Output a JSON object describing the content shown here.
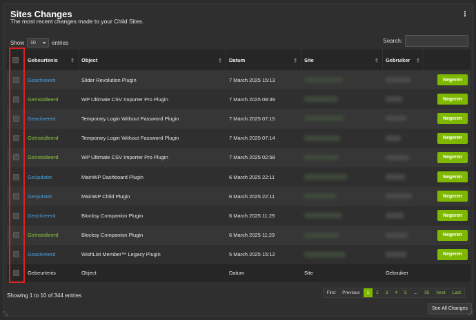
{
  "widget": {
    "title": "Sites Changes",
    "subtitle": "The most recent changes made to your Child Sites."
  },
  "controls": {
    "show_label": "Show",
    "show_value": "10",
    "entries_label": "entries",
    "search_label": "Search:"
  },
  "table": {
    "headers": [
      "Gebeurtenis",
      "Object",
      "Datum",
      "Site",
      "Gebruiker"
    ],
    "rows": [
      {
        "event": "Geactiveerd",
        "event_color": "#4a9fe0",
        "object": "Slider Revolution Plugin",
        "date": "7 March 2025 15:13",
        "action": "Negeren"
      },
      {
        "event": "Geïnstalleerd",
        "event_color": "#8cc63f",
        "object": "WP Ultimate CSV Importer Pro Plugin",
        "date": "7 March 2025 08:39",
        "action": "Negeren"
      },
      {
        "event": "Geactiveerd",
        "event_color": "#4a9fe0",
        "object": "Temporary Login Without Password Plugin",
        "date": "7 March 2025 07:15",
        "action": "Negeren"
      },
      {
        "event": "Geïnstalleerd",
        "event_color": "#8cc63f",
        "object": "Temporary Login Without Password Plugin",
        "date": "7 March 2025 07:14",
        "action": "Negeren"
      },
      {
        "event": "Geïnstalleerd",
        "event_color": "#8cc63f",
        "object": "WP Ultimate CSV Importer Pro Plugin",
        "date": "7 March 2025 02:58",
        "action": "Negeren"
      },
      {
        "event": "Geüpdatet",
        "event_color": "#4a9fe0",
        "object": "MainWP Dashboard Plugin",
        "date": "6 March 2025 22:11",
        "action": "Negeren"
      },
      {
        "event": "Geüpdatet",
        "event_color": "#4a9fe0",
        "object": "MainWP Child Plugin",
        "date": "6 March 2025 22:11",
        "action": "Negeren"
      },
      {
        "event": "Geactiveerd",
        "event_color": "#4a9fe0",
        "object": "Blocksy Companion Plugin",
        "date": "6 March 2025 11:29",
        "action": "Negeren"
      },
      {
        "event": "Geïnstalleerd",
        "event_color": "#8cc63f",
        "object": "Blocksy Companion Plugin",
        "date": "6 March 2025 11:29",
        "action": "Negeren"
      },
      {
        "event": "Geactiveerd",
        "event_color": "#4a9fe0",
        "object": "WishList Member™ Legacy Plugin",
        "date": "5 March 2025 15:12",
        "action": "Negeren"
      }
    ],
    "footers": [
      "Gebeurtenis",
      "Object",
      "Datum",
      "Site",
      "Gebruiker"
    ]
  },
  "footer": {
    "info": "Showing 1 to 10 of 344 entries",
    "pagination": [
      "First",
      "Previous",
      "1",
      "2",
      "3",
      "4",
      "5",
      "...",
      "35",
      "Next",
      "Last"
    ],
    "active_page": "1",
    "see_all": "See All Changes"
  },
  "colors": {
    "accent": "#7fb800",
    "highlight_border": "#e02020"
  }
}
